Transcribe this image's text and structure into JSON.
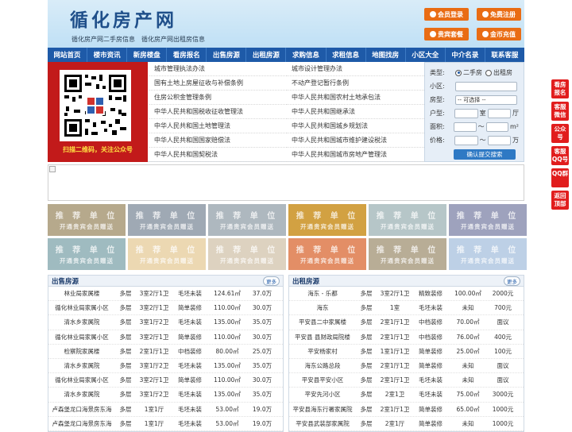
{
  "header": {
    "logo": "循化房产网",
    "slogan": "循化房产网二手房信息　循化房产网出租房信息",
    "buttons": [
      {
        "label": "会员登录",
        "icon": "user-icon"
      },
      {
        "label": "免费注册",
        "icon": "register-icon"
      },
      {
        "label": "贵宾套餐",
        "icon": "vip-icon"
      },
      {
        "label": "金币充值",
        "icon": "coin-icon"
      }
    ],
    "accent": "#e96c14"
  },
  "nav": [
    "网站首页",
    "楼市资讯",
    "新房楼盘",
    "看房报名",
    "出售房源",
    "出租房源",
    "求购信息",
    "求租信息",
    "地图找房",
    "小区大全",
    "中介名录",
    "联系客服"
  ],
  "qr": {
    "caption": "扫描二维码，关注公众号"
  },
  "laws": {
    "left": [
      "城市管理执法办法",
      "国有土地上房屋征收与补偿条例",
      "住房公积金管理条例",
      "中华人民共和国税收征收管理法",
      "中华人民共和国土地管理法",
      "中华人民共和国国家赔偿法",
      "中华人民共和国契税法"
    ],
    "right": [
      "城市设计管理办法",
      "不动产登记暂行条例",
      "中华人民共和国农村土地承包法",
      "中华人民共和国继承法",
      "中华人民共和国城乡规划法",
      "中华人民共和国城市维护建设税法",
      "中华人民共和国城市房地产管理法"
    ]
  },
  "search": {
    "type_label": "类型:",
    "opt1": "二手房",
    "opt2": "出租房",
    "area_label": "小区:",
    "house_label": "房型:",
    "house_value": "-- 可选择 --",
    "layout_label": "户型:",
    "room_unit": "室",
    "hall_unit": "厅",
    "size_label": "面积:",
    "size_sep": "〜",
    "size_unit": "m²",
    "price_label": "价格:",
    "price_sep": "〜",
    "price_unit": "万",
    "submit": "确认提交搜索"
  },
  "promos": {
    "line1": "推 荐 单 位",
    "line2": "开通贵宾会员赠送",
    "colors": [
      "#b6a98c",
      "#9fa9b4",
      "#aeb8bf",
      "#d2a142",
      "#b6c6c8",
      "#9ea2bd",
      "#9fbbc0",
      "#ecd8b2",
      "#ddd2c0",
      "#e38e66",
      "#b8ad96",
      "#bdd0e6"
    ]
  },
  "sale": {
    "title": "出售房源",
    "more": "更多",
    "rows": [
      [
        "林业局家属楼",
        "多层",
        "3室2厅1卫",
        "毛坯未装",
        "124.61㎡",
        "37.0万"
      ],
      [
        "循化林业局家属小区",
        "多层",
        "3室2厅1卫",
        "简单装修",
        "110.00㎡",
        "30.0万"
      ],
      [
        "清水乡家属院",
        "多层",
        "3室1厅2卫",
        "毛坯未装",
        "135.00㎡",
        "35.0万"
      ],
      [
        "循化林业局家属小区",
        "多层",
        "3室2厅1卫",
        "简单装修",
        "110.00㎡",
        "30.0万"
      ],
      [
        "检察院家属楼",
        "多层",
        "2室1厅1卫",
        "中档装修",
        "80.00㎡",
        "25.0万"
      ],
      [
        "清水乡家属院",
        "多层",
        "3室1厅2卫",
        "毛坯未装",
        "135.00㎡",
        "35.0万"
      ],
      [
        "循化林业局家属小区",
        "多层",
        "3室2厅1卫",
        "简单装修",
        "110.00㎡",
        "30.0万"
      ],
      [
        "清水乡家属院",
        "多层",
        "3室1厅2卫",
        "毛坯未装",
        "135.00㎡",
        "35.0万"
      ],
      [
        "卢森堡龙口海景房东海",
        "多层",
        "1室1厅",
        "毛坯未装",
        "53.00㎡",
        "19.0万"
      ],
      [
        "卢森堡龙口海景房东海",
        "多层",
        "1室1厅",
        "毛坯未装",
        "53.00㎡",
        "19.0万"
      ]
    ]
  },
  "rent": {
    "title": "出租房源",
    "more": "更多",
    "rows": [
      [
        "海东 - 乐都",
        "多层",
        "3室2厅1卫",
        "精致装修",
        "100.00㎡",
        "2000元"
      ],
      [
        "海东",
        "多层",
        "1室",
        "毛坯未装",
        "未知",
        "700元"
      ],
      [
        "平安县二中家属楼",
        "多层",
        "2室1厅1卫",
        "中档装修",
        "70.00㎡",
        "面议"
      ],
      [
        "平安县 县财政局院楼",
        "多层",
        "2室1厅1卫",
        "中档装修",
        "76.00㎡",
        "400元"
      ],
      [
        "平安杨家村",
        "多层",
        "1室1厅1卫",
        "简单装修",
        "25.00㎡",
        "100元"
      ],
      [
        "海东公路总段",
        "多层",
        "2室1厅1卫",
        "简单装修",
        "未知",
        "面议"
      ],
      [
        "平安县平安小区",
        "多层",
        "2室1厅1卫",
        "毛坯未装",
        "未知",
        "面议"
      ],
      [
        "平安先河小区",
        "多层",
        "2室1卫",
        "毛坯未装",
        "75.00㎡",
        "3000元"
      ],
      [
        "平安县海东行署家属院",
        "多层",
        "2室1厅1卫",
        "简单装修",
        "65.00㎡",
        "1000元"
      ],
      [
        "平安县武装部家属院",
        "多层",
        "2室1厅",
        "简单装修",
        "未知",
        "1000元"
      ]
    ]
  },
  "sidebar": [
    "看房报名",
    "客服微信",
    "公众号",
    "客服QQ号",
    "QQ群",
    "返回顶部"
  ],
  "sidebar_color": "#e11d1d"
}
